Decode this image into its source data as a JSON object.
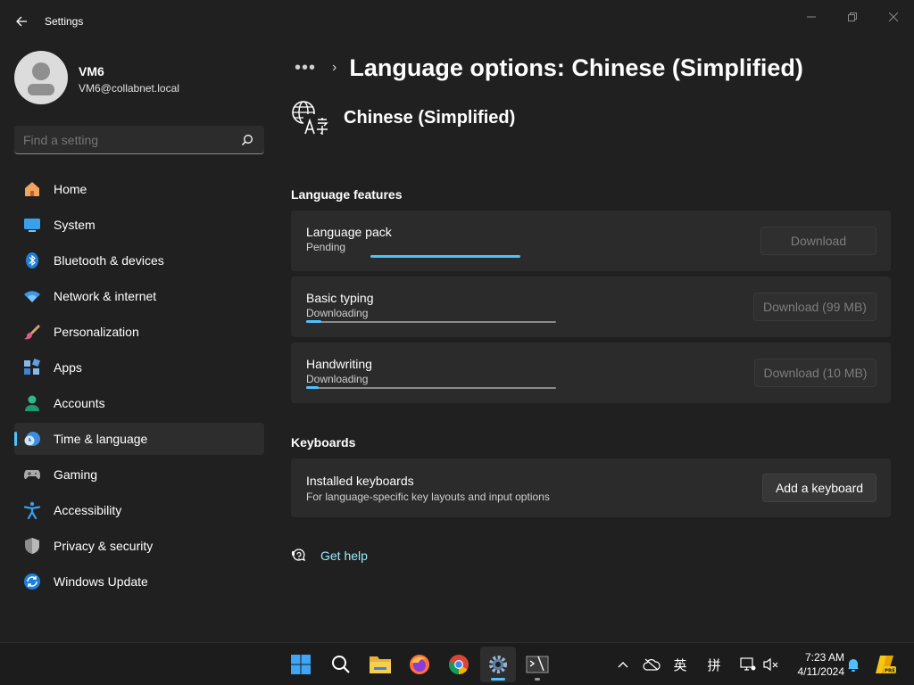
{
  "window": {
    "title": "Settings"
  },
  "user": {
    "name": "VM6",
    "email": "VM6@collabnet.local"
  },
  "search": {
    "placeholder": "Find a setting"
  },
  "nav": [
    {
      "label": "Home",
      "icon": "home-icon"
    },
    {
      "label": "System",
      "icon": "system-icon"
    },
    {
      "label": "Bluetooth & devices",
      "icon": "bluetooth-icon"
    },
    {
      "label": "Network & internet",
      "icon": "wifi-icon"
    },
    {
      "label": "Personalization",
      "icon": "brush-icon"
    },
    {
      "label": "Apps",
      "icon": "apps-icon"
    },
    {
      "label": "Accounts",
      "icon": "accounts-icon"
    },
    {
      "label": "Time & language",
      "icon": "time-language-icon",
      "active": true
    },
    {
      "label": "Gaming",
      "icon": "gamepad-icon"
    },
    {
      "label": "Accessibility",
      "icon": "accessibility-icon"
    },
    {
      "label": "Privacy & security",
      "icon": "shield-icon"
    },
    {
      "label": "Windows Update",
      "icon": "update-icon"
    }
  ],
  "breadcrumb": {
    "more": "•••",
    "title": "Language options: Chinese (Simplified)"
  },
  "language": {
    "name": "Chinese (Simplified)"
  },
  "features": {
    "title": "Language features",
    "items": [
      {
        "title": "Language pack",
        "status": "Pending",
        "button": "Download",
        "progress": null
      },
      {
        "title": "Basic typing",
        "status": "Downloading",
        "button": "Download (99 MB)",
        "progress": 0.06
      },
      {
        "title": "Handwriting",
        "status": "Downloading",
        "button": "Download (10 MB)",
        "progress": 0.05
      }
    ]
  },
  "keyboards": {
    "title": "Keyboards",
    "installed_title": "Installed keyboards",
    "installed_sub": "For language-specific key layouts and input options",
    "add_button": "Add a keyboard"
  },
  "help": {
    "label": "Get help"
  },
  "taskbar": {
    "apps": [
      "windows-start-icon",
      "search-icon",
      "file-explorer-icon",
      "firefox-icon",
      "chrome-icon",
      "settings-gear-icon",
      "terminal-icon"
    ],
    "tray": {
      "ime_mode": "英",
      "ime_name": "拼"
    },
    "time": "7:23 AM",
    "date": "4/11/2024"
  },
  "colors": {
    "accent": "#4cc2ff",
    "link": "#99ebff",
    "background": "#202020",
    "card": "#2b2b2b"
  }
}
